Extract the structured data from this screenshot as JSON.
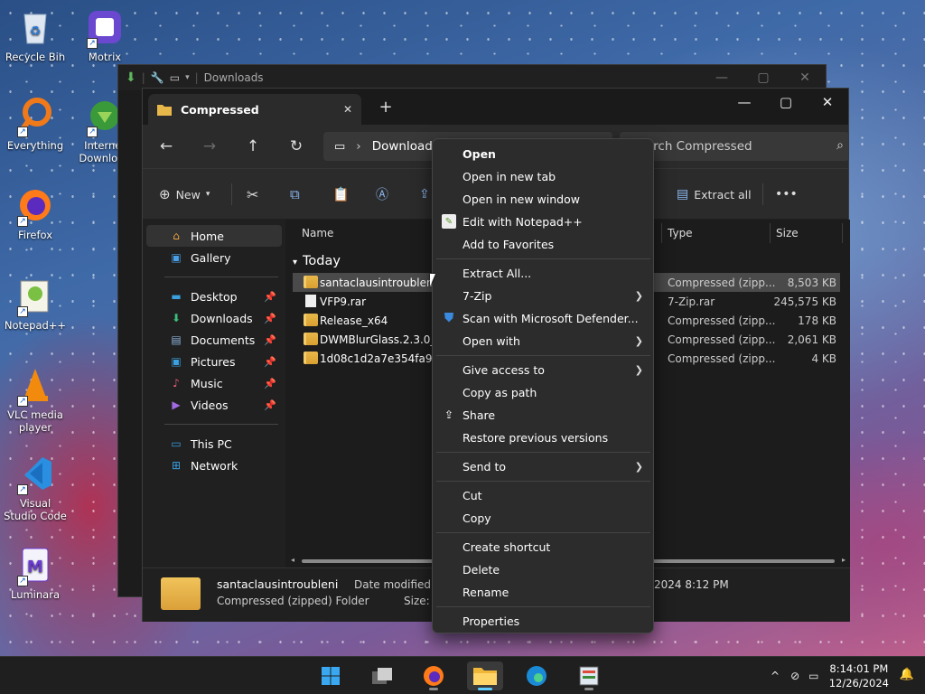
{
  "desktop": {
    "icons": [
      {
        "label": "Recycle Bin"
      },
      {
        "label": "Motrix"
      },
      {
        "label": "Everything"
      },
      {
        "label": "Internet Download"
      },
      {
        "label": "Firefox"
      },
      {
        "label": "Notepad++"
      },
      {
        "label": "VLC media player"
      },
      {
        "label": "Visual Studio Code"
      },
      {
        "label": "Luminara"
      }
    ]
  },
  "back_window": {
    "title": "Downloads"
  },
  "explorer": {
    "tab_title": "Compressed",
    "address": {
      "root_glyph": "›",
      "crumb": "Downloads"
    },
    "search": {
      "placeholder": "Search Compressed"
    },
    "toolbar": {
      "new_label": "New",
      "extract_all": "Extract all",
      "more": "•••"
    },
    "sidebar": {
      "home": "Home",
      "gallery": "Gallery",
      "pinned": [
        "Desktop",
        "Downloads",
        "Documents",
        "Pictures",
        "Music",
        "Videos"
      ],
      "this_pc": "This PC",
      "network": "Network"
    },
    "columns": {
      "name": "Name",
      "type": "Type",
      "size": "Size"
    },
    "group": "Today",
    "files": [
      {
        "name": "santaclausintroubleni",
        "type": "Compressed (zipp...",
        "size": "8,503 KB",
        "selected": true
      },
      {
        "name": "VFP9.rar",
        "type": "7-Zip.rar",
        "size": "245,575 KB"
      },
      {
        "name": "Release_x64",
        "type": "Compressed (zipp...",
        "size": "178 KB"
      },
      {
        "name": "DWMBlurGlass.2.3.0_x6",
        "type": "Compressed (zipp...",
        "size": "2,061 KB"
      },
      {
        "name": "1d08c1d2a7e354fa9fd66",
        "type": "Compressed (zipp...",
        "size": "4 KB"
      }
    ],
    "details": {
      "name": "santaclausintroubleni",
      "kind": "Compressed (zipped) Folder",
      "date_label": "Date modified:",
      "date_value": "2024 8:12 PM",
      "size_label": "Size:"
    }
  },
  "context_menu": {
    "items": [
      {
        "label": "Open",
        "bold": true
      },
      {
        "label": "Open in new tab"
      },
      {
        "label": "Open in new window"
      },
      {
        "label": "Edit with Notepad++"
      },
      {
        "label": "Add to Favorites"
      },
      {
        "label": "Extract All..."
      },
      {
        "label": "7-Zip"
      },
      {
        "label": "Scan with Microsoft Defender..."
      },
      {
        "label": "Open with"
      },
      {
        "label": "Give access to"
      },
      {
        "label": "Copy as path"
      },
      {
        "label": "Share"
      },
      {
        "label": "Restore previous versions"
      },
      {
        "label": "Send to"
      },
      {
        "label": "Cut"
      },
      {
        "label": "Copy"
      },
      {
        "label": "Create shortcut"
      },
      {
        "label": "Delete"
      },
      {
        "label": "Rename"
      },
      {
        "label": "Properties"
      }
    ]
  },
  "taskbar": {
    "clock_time": "8:14:01 PM",
    "clock_date": "12/26/2024",
    "tray_chevron": "^"
  }
}
